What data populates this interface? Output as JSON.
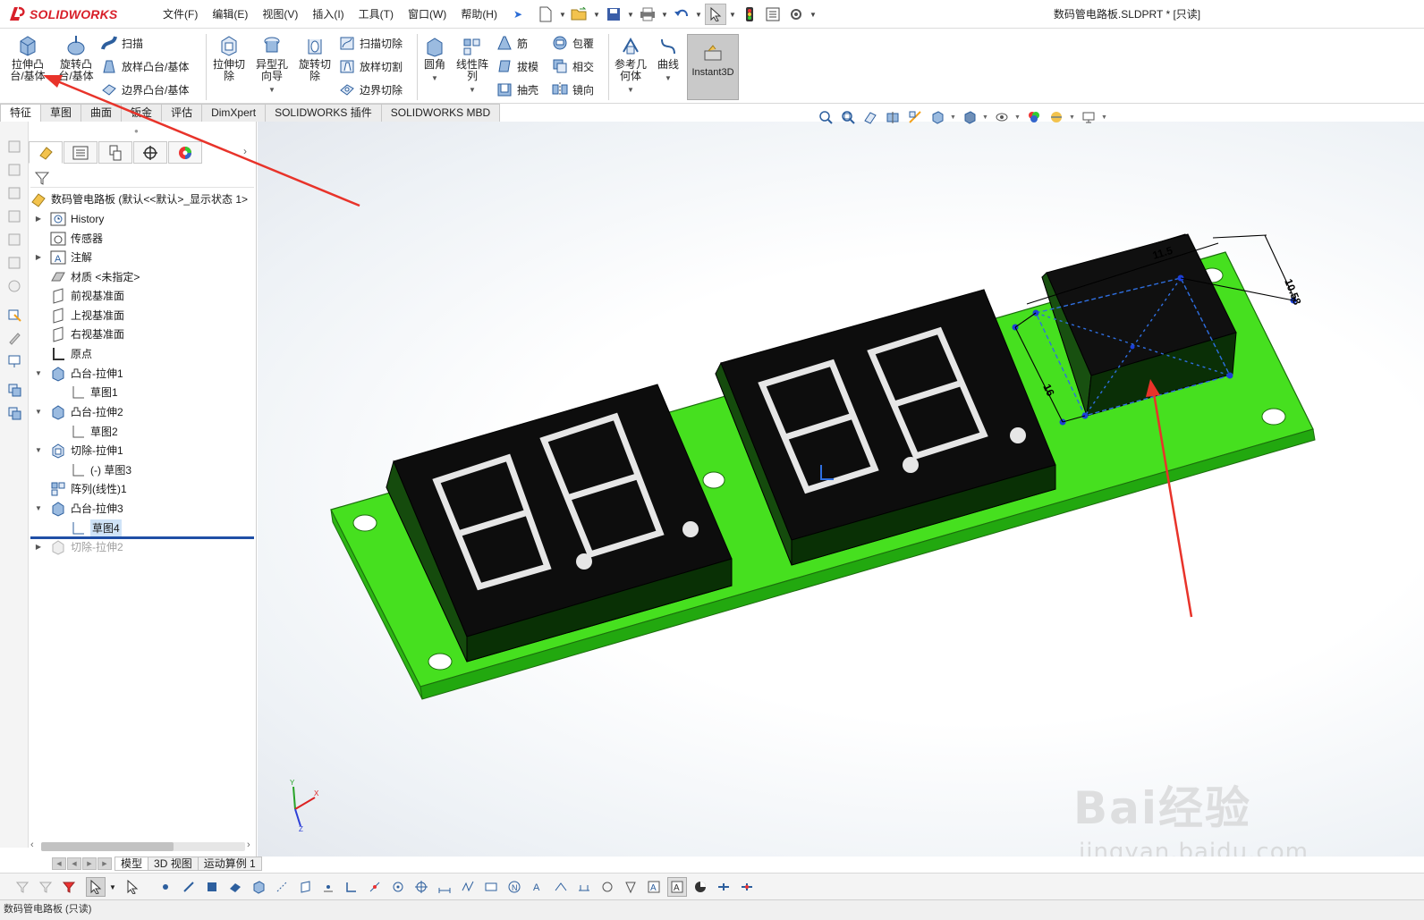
{
  "brand": {
    "logo_text": "SOLIDWORKS"
  },
  "menus": [
    "文件(F)",
    "编辑(E)",
    "视图(V)",
    "插入(I)",
    "工具(T)",
    "窗口(W)",
    "帮助(H)"
  ],
  "document_title": "数码管电路板.SLDPRT * [只读]",
  "command_manager": {
    "extrude_boss": "拉伸凸台/基体",
    "revolve_boss": "旋转凸台/基体",
    "sweep": "扫描",
    "loft": "放样凸台/基体",
    "boundary": "边界凸台/基体",
    "extrude_cut": "拉伸切除",
    "hole_wizard": "异型孔向导",
    "revolve_cut": "旋转切除",
    "sweep_cut": "扫描切除",
    "loft_cut": "放样切割",
    "boundary_cut": "边界切除",
    "fillet": "圆角",
    "linear_pattern": "线性阵列",
    "rib": "筋",
    "draft": "拔模",
    "shell": "抽壳",
    "wrap": "包覆",
    "intersect": "相交",
    "mirror": "镜向",
    "ref_geometry": "参考几何体",
    "curves": "曲线",
    "instant3d": "Instant3D"
  },
  "command_tabs": [
    "特征",
    "草图",
    "曲面",
    "钣金",
    "评估",
    "DimXpert",
    "SOLIDWORKS 插件",
    "SOLIDWORKS MBD"
  ],
  "feature_tree": {
    "root": "数码管电路板  (默认<<默认>_显示状态 1>",
    "items": [
      {
        "label": "History"
      },
      {
        "label": "传感器"
      },
      {
        "label": "注解"
      },
      {
        "label": "材质 <未指定>"
      },
      {
        "label": "前视基准面"
      },
      {
        "label": "上视基准面"
      },
      {
        "label": "右视基准面"
      },
      {
        "label": "原点"
      },
      {
        "label": "凸台-拉伸1"
      },
      {
        "label": "草图1"
      },
      {
        "label": "凸台-拉伸2"
      },
      {
        "label": "草图2"
      },
      {
        "label": "切除-拉伸1"
      },
      {
        "label": "(-) 草图3"
      },
      {
        "label": "阵列(线性)1"
      },
      {
        "label": "凸台-拉伸3"
      },
      {
        "label": "草图4"
      },
      {
        "label": "切除-拉伸2"
      }
    ]
  },
  "model_tabs": [
    "模型",
    "3D 视图",
    "运动算例 1"
  ],
  "viewport": {
    "dimension_1": "10.58",
    "dimension_2": "16",
    "dimension_3": "11.5"
  },
  "watermark": {
    "line1": "Bai经验",
    "line2": "jingyan.baidu.com"
  },
  "status_text": "数码管电路板 (只读)",
  "colors": {
    "pcb": "#3fdc1e",
    "pcb_side": "#24a511",
    "display_top": "#111111",
    "display_side": "#0f3a0a",
    "annotation_arrow": "#e8332a",
    "sketch_blue": "#2f6fe0"
  }
}
